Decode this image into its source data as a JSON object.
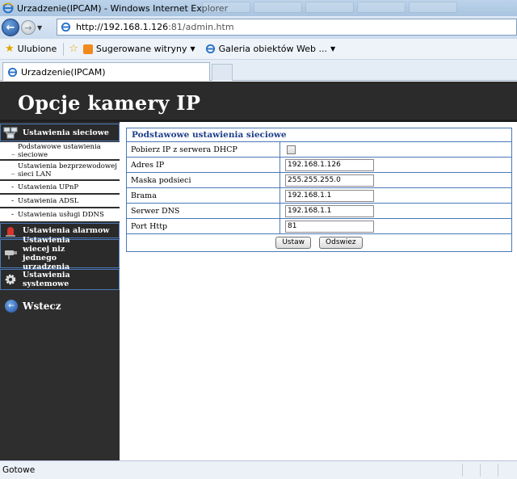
{
  "window": {
    "title": "Urzadzenie(IPCAM) - Windows Internet Explorer"
  },
  "nav": {
    "url_host": "http://192.168.1.126",
    "url_rest": ":81/admin.htm"
  },
  "favorites": {
    "ulubione": "Ulubione",
    "sugerowane": "Sugerowane witryny",
    "galeria": "Galeria obiektów Web ..."
  },
  "tab": {
    "label": "Urzadzenie(IPCAM)"
  },
  "page": {
    "heading": "Opcje kamery IP"
  },
  "sidebar": {
    "network": "Ustawienia sieciowe",
    "network_items": [
      "Podstawowe ustawienia sieciowe",
      "Ustawienia bezprzewodowej sieci LAN",
      "Ustawienia UPnP",
      "Ustawienia ADSL",
      "Ustawienia usługi DDNS"
    ],
    "alarm": "Ustawienia alarmow",
    "multi": "Ustawienia wiecej niz jednego urzadzenia",
    "system": "Ustawienia systemowe",
    "back": "Wstecz"
  },
  "form": {
    "title": "Podstawowe ustawienia sieciowe",
    "dhcp_label": "Pobierz IP z serwera DHCP",
    "ip_label": "Adres IP",
    "ip_value": "192.168.1.126",
    "mask_label": "Maska podsieci",
    "mask_value": "255.255.255.0",
    "gateway_label": "Brama",
    "gateway_value": "192.168.1.1",
    "dns_label": "Serwer DNS",
    "dns_value": "192.168.1.1",
    "port_label": "Port Http",
    "port_value": "81",
    "set_button": "Ustaw",
    "refresh_button": "Odswiez"
  },
  "status": {
    "text": "Gotowe"
  },
  "colors": {
    "header_bg": "#2b2b2b",
    "sidebar_bg": "#2e2e2e",
    "accent_border": "#4a78b8",
    "form_title": "#1f3f8a"
  }
}
